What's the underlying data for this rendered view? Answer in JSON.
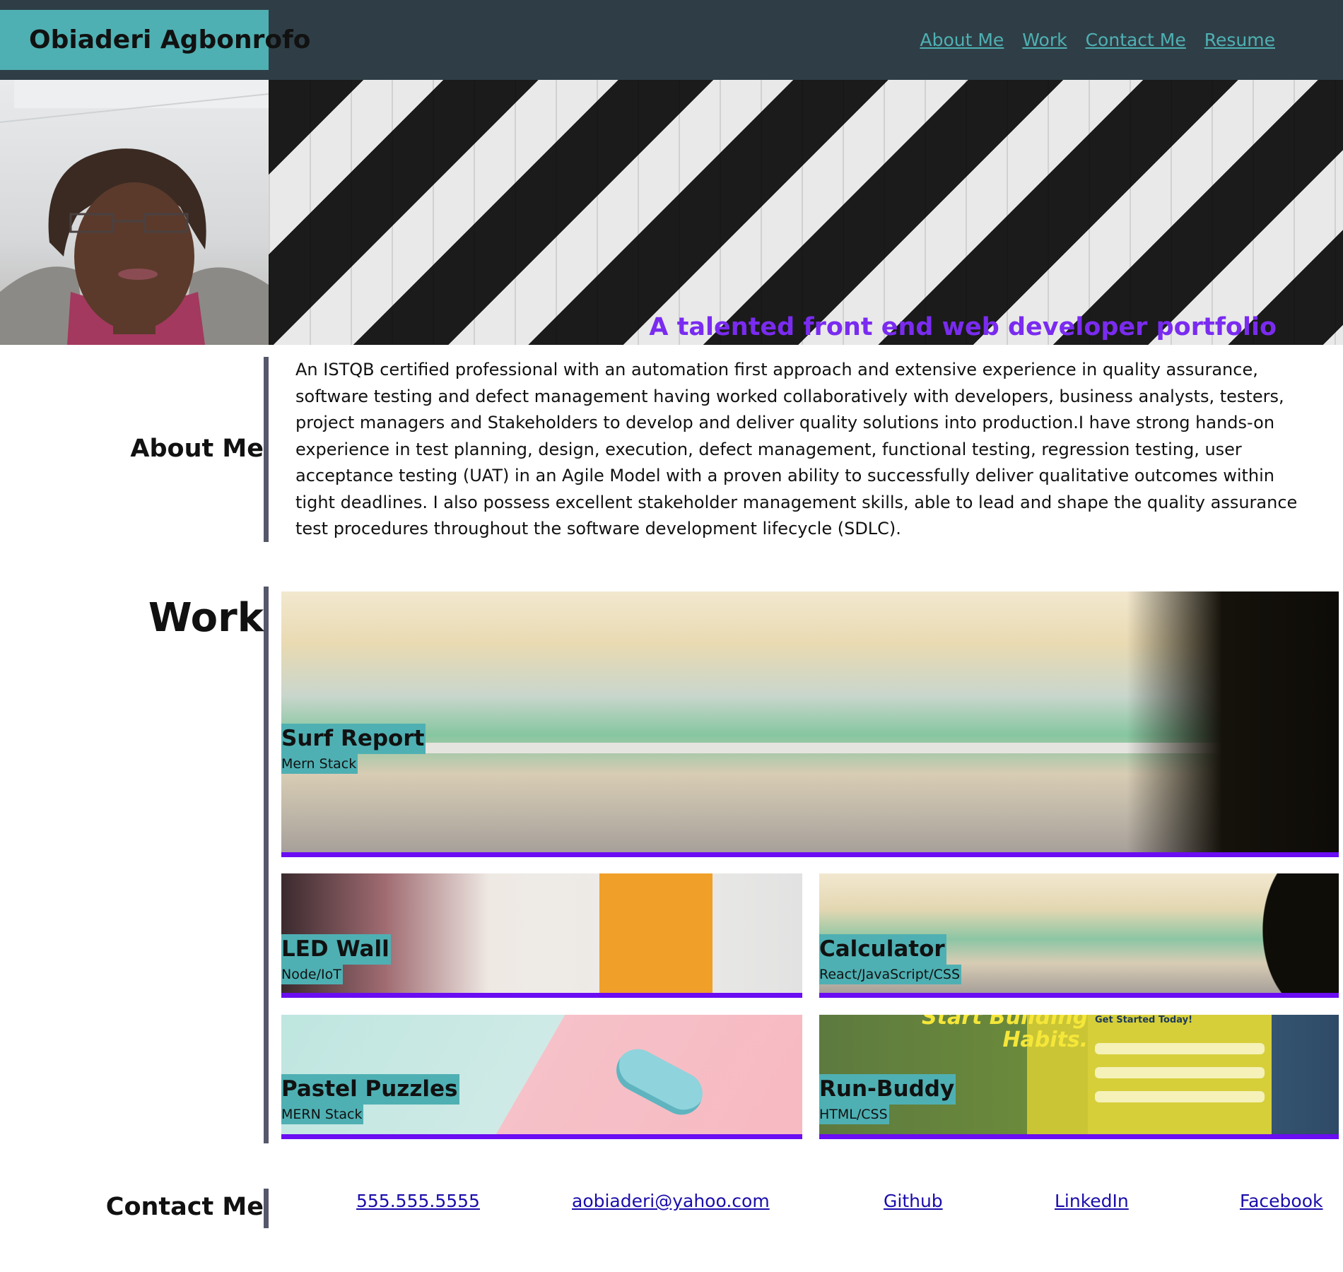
{
  "header": {
    "brand": "Obiaderi Agbonrofo",
    "nav": [
      "About Me",
      "Work",
      "Contact Me",
      "Resume"
    ],
    "accent_color": "#4fb0b3",
    "bar_color": "#2f3e46"
  },
  "hero": {
    "tagline": "A talented front end web developer portfolio",
    "tagline_color": "#7a2bf0"
  },
  "about": {
    "heading": "About Me",
    "text": "An ISTQB certified professional with an automation first approach and extensive experience in quality assurance, software testing and defect management having worked collaboratively with developers, business analysts, testers, project managers and Stakeholders to develop and deliver quality solutions into production.I have strong hands-on experience in test planning, design, execution, defect management, functional testing, regression testing, user acceptance testing (UAT) in an Agile Model with a proven ability to successfully deliver qualitative outcomes within tight deadlines. I also possess excellent stakeholder management skills, able to lead and shape the quality assurance test procedures throughout the software development lifecycle (SDLC)."
  },
  "work": {
    "heading": "Work",
    "projects": [
      {
        "title": "Surf Report",
        "stack": "Mern Stack"
      },
      {
        "title": "LED Wall",
        "stack": "Node/IoT"
      },
      {
        "title": "Calculator",
        "stack": "React/JavaScript/CSS"
      },
      {
        "title": "Pastel Puzzles",
        "stack": "MERN Stack"
      },
      {
        "title": "Run-Buddy",
        "stack": "HTML/CSS"
      }
    ],
    "run_buddy_headline_1": "Start Building",
    "run_buddy_headline_2": "Habits.",
    "run_buddy_form_title": "Get Started Today!",
    "border_color": "#6a0df2"
  },
  "contact": {
    "heading": "Contact Me",
    "links": [
      "555.555.5555",
      "aobiaderi@yahoo.com",
      "Github",
      "LinkedIn",
      "Facebook"
    ]
  }
}
